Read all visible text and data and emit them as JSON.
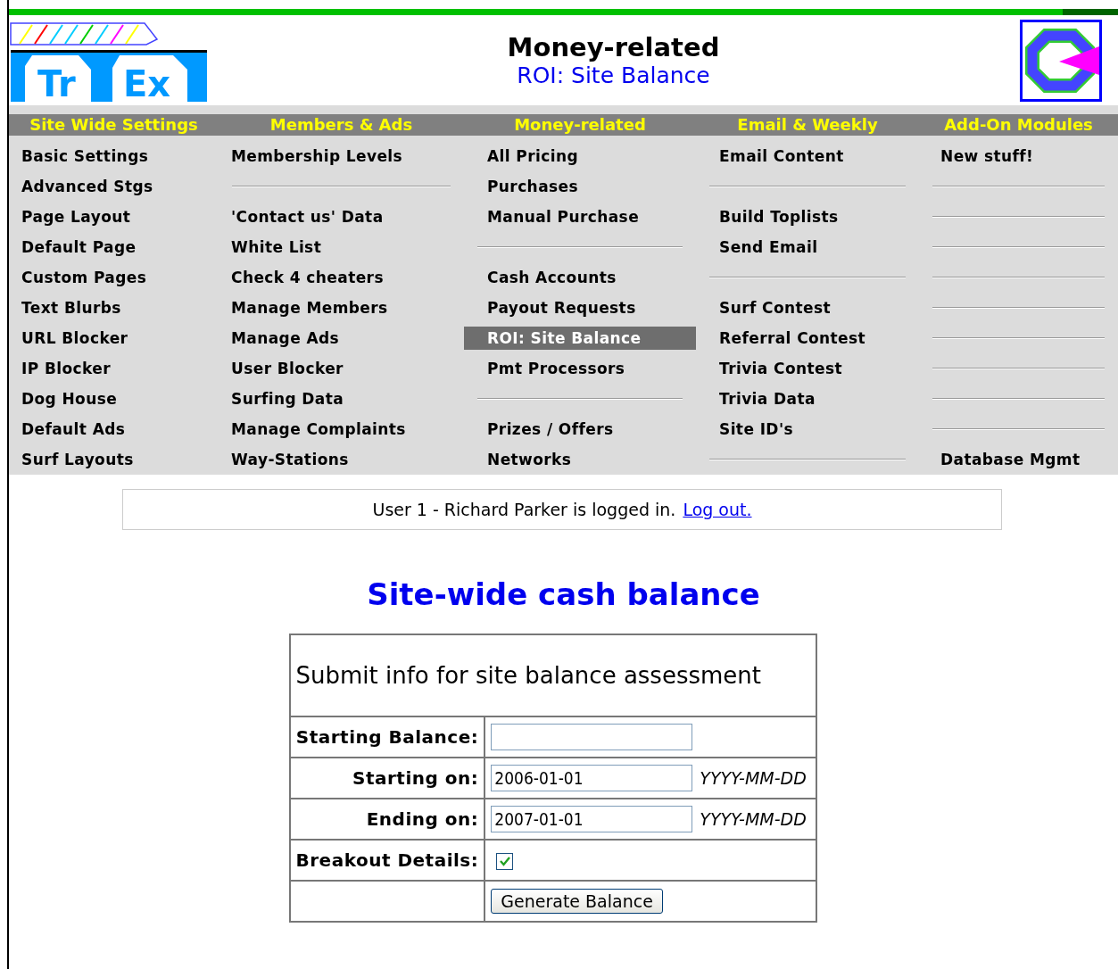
{
  "header": {
    "logo_letters": [
      "Tr",
      "Ex"
    ],
    "title": "Money-related",
    "subtitle": "ROI: Site Balance"
  },
  "menu": [
    {
      "heading": "Site Wide Settings",
      "items": [
        {
          "kind": "link",
          "label": "Basic Settings",
          "selected": false
        },
        {
          "kind": "link",
          "label": "Advanced Stgs",
          "selected": false
        },
        {
          "kind": "link",
          "label": "Page Layout",
          "selected": false
        },
        {
          "kind": "link",
          "label": "Default Page",
          "selected": false
        },
        {
          "kind": "link",
          "label": "Custom Pages",
          "selected": false
        },
        {
          "kind": "link",
          "label": "Text Blurbs",
          "selected": false
        },
        {
          "kind": "link",
          "label": "URL Blocker",
          "selected": false
        },
        {
          "kind": "link",
          "label": "IP Blocker",
          "selected": false
        },
        {
          "kind": "link",
          "label": "Dog House",
          "selected": false
        },
        {
          "kind": "link",
          "label": "Default Ads",
          "selected": false
        },
        {
          "kind": "link",
          "label": "Surf Layouts",
          "selected": false
        }
      ]
    },
    {
      "heading": "Members & Ads",
      "items": [
        {
          "kind": "link",
          "label": "Membership Levels",
          "selected": false
        },
        {
          "kind": "separator"
        },
        {
          "kind": "link",
          "label": "'Contact us' Data",
          "selected": false
        },
        {
          "kind": "link",
          "label": "White List",
          "selected": false
        },
        {
          "kind": "link",
          "label": "Check 4 cheaters",
          "selected": false
        },
        {
          "kind": "link",
          "label": "Manage Members",
          "selected": false
        },
        {
          "kind": "link",
          "label": "Manage Ads",
          "selected": false
        },
        {
          "kind": "link",
          "label": "User Blocker",
          "selected": false
        },
        {
          "kind": "link",
          "label": "Surfing Data",
          "selected": false
        },
        {
          "kind": "link",
          "label": "Manage Complaints",
          "selected": false
        },
        {
          "kind": "link",
          "label": "Way-Stations",
          "selected": false
        }
      ]
    },
    {
      "heading": "Money-related",
      "items": [
        {
          "kind": "link",
          "label": "All Pricing",
          "selected": false
        },
        {
          "kind": "link",
          "label": "Purchases",
          "selected": false
        },
        {
          "kind": "link",
          "label": "Manual Purchase",
          "selected": false
        },
        {
          "kind": "separator"
        },
        {
          "kind": "link",
          "label": "Cash Accounts",
          "selected": false
        },
        {
          "kind": "link",
          "label": "Payout Requests",
          "selected": false
        },
        {
          "kind": "link",
          "label": "ROI: Site Balance",
          "selected": true
        },
        {
          "kind": "link",
          "label": "Pmt Processors",
          "selected": false
        },
        {
          "kind": "separator"
        },
        {
          "kind": "link",
          "label": "Prizes / Offers",
          "selected": false
        },
        {
          "kind": "link",
          "label": "Networks",
          "selected": false
        }
      ]
    },
    {
      "heading": "Email & Weekly",
      "items": [
        {
          "kind": "link",
          "label": "Email Content",
          "selected": false
        },
        {
          "kind": "separator"
        },
        {
          "kind": "link",
          "label": "Build Toplists",
          "selected": false
        },
        {
          "kind": "link",
          "label": "Send Email",
          "selected": false
        },
        {
          "kind": "separator"
        },
        {
          "kind": "link",
          "label": "Surf Contest",
          "selected": false
        },
        {
          "kind": "link",
          "label": "Referral Contest",
          "selected": false
        },
        {
          "kind": "link",
          "label": "Trivia Contest",
          "selected": false
        },
        {
          "kind": "link",
          "label": "Trivia Data",
          "selected": false
        },
        {
          "kind": "link",
          "label": "Site ID's",
          "selected": false
        },
        {
          "kind": "separator"
        }
      ]
    },
    {
      "heading": "Add-On Modules",
      "items": [
        {
          "kind": "link",
          "label": "New stuff!",
          "selected": false
        },
        {
          "kind": "separator"
        },
        {
          "kind": "separator"
        },
        {
          "kind": "separator"
        },
        {
          "kind": "separator"
        },
        {
          "kind": "separator"
        },
        {
          "kind": "separator"
        },
        {
          "kind": "separator"
        },
        {
          "kind": "separator"
        },
        {
          "kind": "separator"
        },
        {
          "kind": "link",
          "label": "Database Mgmt",
          "selected": false
        }
      ]
    }
  ],
  "login": {
    "message": "User 1 - Richard Parker is logged in.",
    "link": "Log out."
  },
  "page_title": "Site-wide cash balance",
  "form": {
    "caption": "Submit info for site balance assessment",
    "rows": [
      {
        "kind": "text",
        "label": "Starting Balance:"
      },
      {
        "kind": "text",
        "label": "Starting on:",
        "value": "2006-01-01",
        "hint": "YYYY-MM-DD"
      },
      {
        "kind": "text",
        "label": "Ending on:",
        "value": "2007-01-01",
        "hint": "YYYY-MM-DD"
      },
      {
        "kind": "checkbox",
        "label": "Breakout Details:",
        "checked": true
      },
      {
        "kind": "button",
        "button": "Generate Balance"
      }
    ]
  }
}
